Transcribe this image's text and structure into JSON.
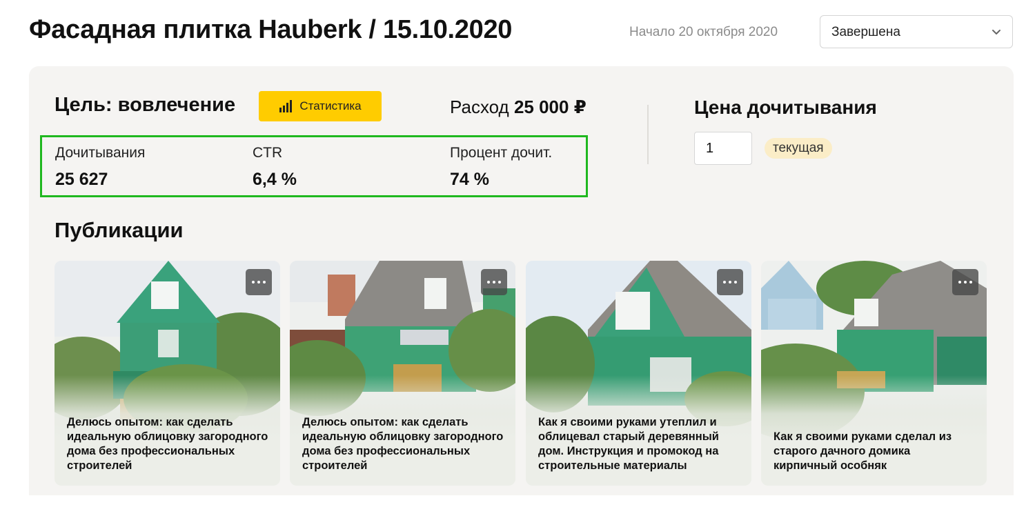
{
  "header": {
    "title": "Фасадная плитка Hauberk / 15.10.2020",
    "start_date": "Начало 20 октября 2020",
    "status_value": "Завершена"
  },
  "campaign": {
    "goal": "Цель: вовлечение",
    "stats_button": "Статистика",
    "spend_label": "Расход",
    "spend_value": "25 000 ₽",
    "metrics": [
      {
        "label": "Дочитывания",
        "value": "25 627"
      },
      {
        "label": "CTR",
        "value": "6,4 %"
      },
      {
        "label": "Процент дочит.",
        "value": "74 %"
      }
    ]
  },
  "pricing": {
    "title": "Цена дочитывания",
    "input_value": "1",
    "badge": "текущая"
  },
  "publications": {
    "title": "Публикации",
    "cards": [
      {
        "caption": "Делюсь опытом: как сделать идеальную облицовку загородного дома без профессиональных строителей"
      },
      {
        "caption": "Делюсь опытом: как сделать идеальную облицовку загородного дома без профессиональных строителей"
      },
      {
        "caption": "Как я своими руками утеплил и облицевал старый деревянный дом. Инструкция и промокод на строительные материалы"
      },
      {
        "caption": "Как я своими руками сделал из старого дачного домика кирпичный особняк"
      }
    ]
  },
  "colors": {
    "accent": "#ffcc00",
    "highlight_border": "#1fb81f",
    "panel_bg": "#f5f4f2",
    "badge_bg": "#fbedc7"
  },
  "icons": {
    "stats": "bar-chart-icon",
    "dropdown": "chevron-down-icon",
    "card_menu": "more-dots-icon"
  }
}
